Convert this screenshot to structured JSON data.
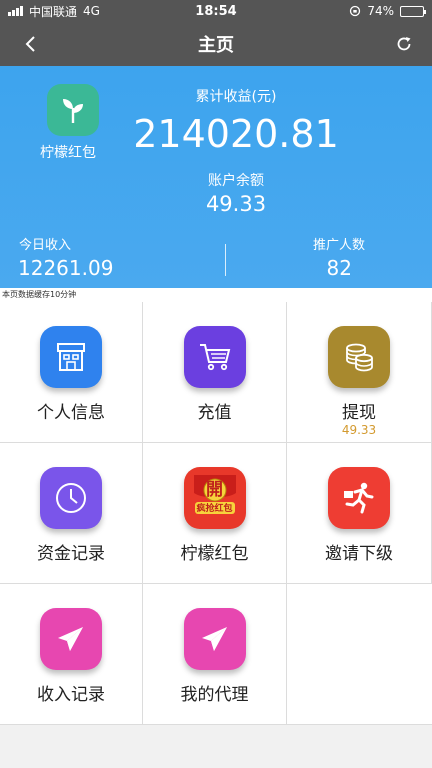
{
  "status_bar": {
    "carrier": "中国联通",
    "network": "4G",
    "time": "18:54",
    "battery_percent": "74%",
    "battery_level": 0.74
  },
  "nav": {
    "title": "主页",
    "back_icon": "chevron-left-icon",
    "refresh_icon": "refresh-icon"
  },
  "hero": {
    "logo_label": "柠檬红包",
    "total_label": "累计收益(元)",
    "total_value": "214020.81",
    "balance_label": "账户余额",
    "balance_value": "49.33",
    "today_label": "今日收入",
    "today_value": "12261.09",
    "promo_label": "推广人数",
    "promo_value": "82"
  },
  "cache_note": "本页数据缓存10分钟",
  "menu": [
    {
      "label": "个人信息",
      "icon": "store-icon",
      "color": "#2f82ee"
    },
    {
      "label": "充值",
      "icon": "cart-icon",
      "color": "#6b3fe0"
    },
    {
      "label": "提现",
      "sub": "49.33",
      "icon": "coins-icon",
      "color": "#a8892e"
    },
    {
      "label": "资金记录",
      "icon": "clock-icon",
      "color": "#7a55ea"
    },
    {
      "label": "柠檬红包",
      "icon": "red-envelope-icon",
      "color": "#e8382a"
    },
    {
      "label": "邀请下级",
      "icon": "runner-icon",
      "color": "#ee3d33"
    },
    {
      "label": "收入记录",
      "icon": "paper-plane-icon",
      "color": "#e747b0"
    },
    {
      "label": "我的代理",
      "icon": "paper-plane-icon",
      "color": "#e747b0"
    }
  ],
  "envelope_badge": {
    "top": "開",
    "bottom": "疯抢红包"
  }
}
